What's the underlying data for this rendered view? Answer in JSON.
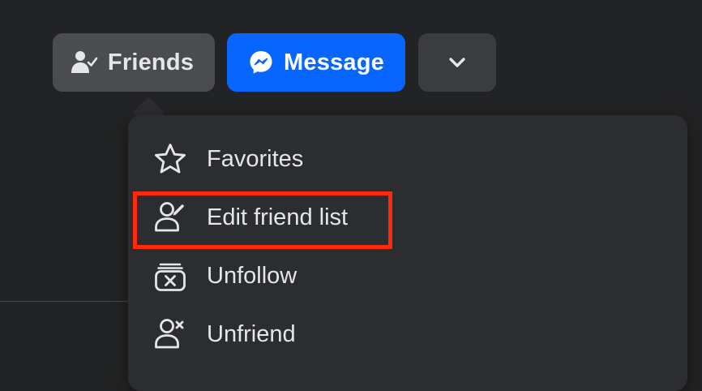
{
  "profile_actions": {
    "friends_label": "Friends",
    "friends_icon": "person-check-icon",
    "message_label": "Message",
    "message_icon": "messenger-icon",
    "more_icon": "chevron-down-icon"
  },
  "friends_menu": {
    "items": [
      {
        "label": "Favorites",
        "icon": "star-icon"
      },
      {
        "label": "Edit friend list",
        "icon": "person-edit-icon",
        "highlighted": true
      },
      {
        "label": "Unfollow",
        "icon": "unfollow-icon"
      },
      {
        "label": "Unfriend",
        "icon": "person-remove-icon"
      }
    ]
  },
  "colors": {
    "background": "#222324",
    "menu_background": "#2c2d30",
    "message_button": "#0866ff",
    "friends_button": "#4b4c4f",
    "highlight": "#fe2a0b",
    "text": "#e4e6eb"
  }
}
